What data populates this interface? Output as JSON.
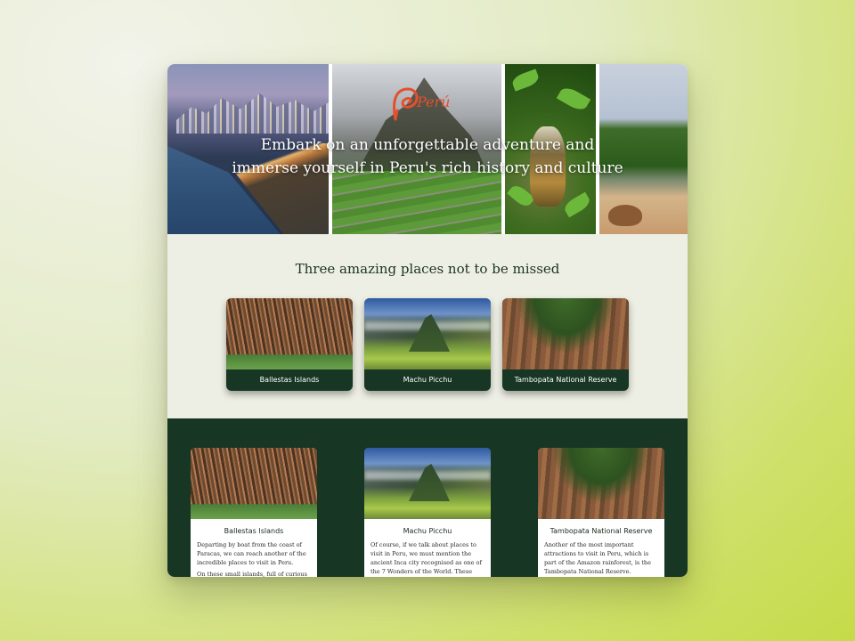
{
  "hero": {
    "logo_text": "Perú",
    "tagline_line1": "Embark on an unforgettable adventure and",
    "tagline_line2": "immerse yourself in Peru's rich history and culture"
  },
  "places": {
    "title": "Three amazing places not to be missed",
    "cards": [
      {
        "label": "Ballestas Islands"
      },
      {
        "label": "Machu Picchu"
      },
      {
        "label": "Tambopata National Reserve"
      }
    ]
  },
  "details": [
    {
      "title": "Ballestas Islands",
      "paragraphs": [
        "Departing by boat from the coast of Paracas, we can reach another of the incredible places to visit in Peru.",
        "On these small islands, full of curious"
      ]
    },
    {
      "title": "Machu Picchu",
      "paragraphs": [
        "Of course, if we talk about places to visit in Peru, we must mention the ancient Inca city recognised as one of the 7 Wonders of the World. These"
      ]
    },
    {
      "title": "Tambopata National Reserve",
      "paragraphs": [
        "Another of the most important attractions to visit in Peru, which is part of the Amazon rainforest, is the Tambopata National Reserve."
      ]
    }
  ],
  "colors": {
    "brand_red": "#e4502d",
    "dark_green": "#173624",
    "section_bg": "#eeefe4"
  }
}
